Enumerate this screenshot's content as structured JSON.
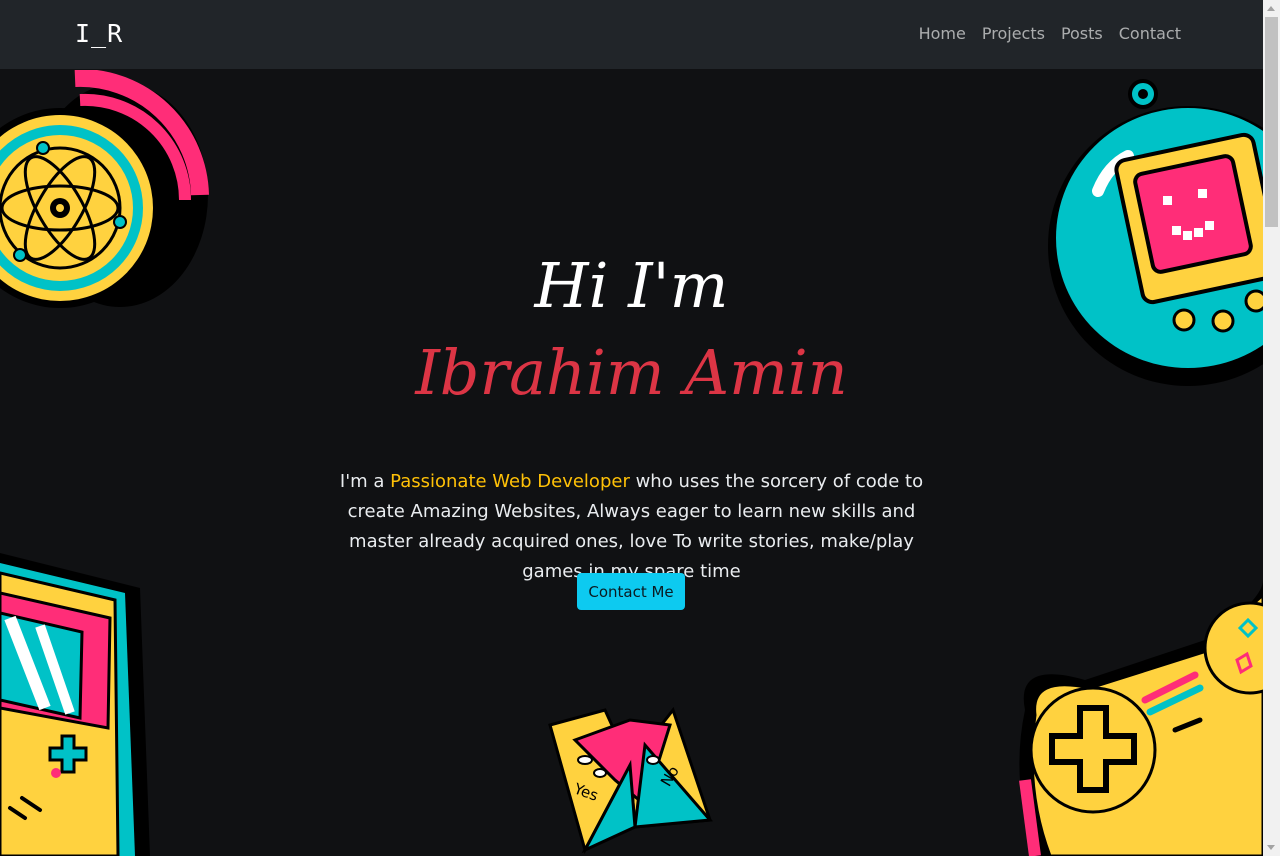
{
  "brand": "I_R",
  "nav": [
    "Home",
    "Projects",
    "Posts",
    "Contact"
  ],
  "hero": {
    "greeting": "Hi I'm",
    "name": "Ibrahim Amin"
  },
  "bio": {
    "prefix": "I'm a ",
    "highlight": "Passionate Web Developer",
    "suffix": " who uses the sorcery of code to create Amazing Websites, Always eager to learn new skills and master already acquired ones, love To write stories, make/play games in my spare time"
  },
  "cta_label": "Contact Me",
  "fortune_teller_words": [
    "Yes",
    "No"
  ],
  "colors": {
    "accent_red": "#dc3545",
    "accent_yellow": "#ffc107",
    "accent_cyan": "#0dcaf0",
    "illus_pink": "#ff2d78",
    "illus_teal": "#00c2c7",
    "illus_yellow": "#ffd23f"
  },
  "illustrations": [
    "atom-coin-illustration",
    "tamagotchi-illustration",
    "gameboy-illustration",
    "fortune-teller-illustration",
    "gamepad-illustration"
  ]
}
